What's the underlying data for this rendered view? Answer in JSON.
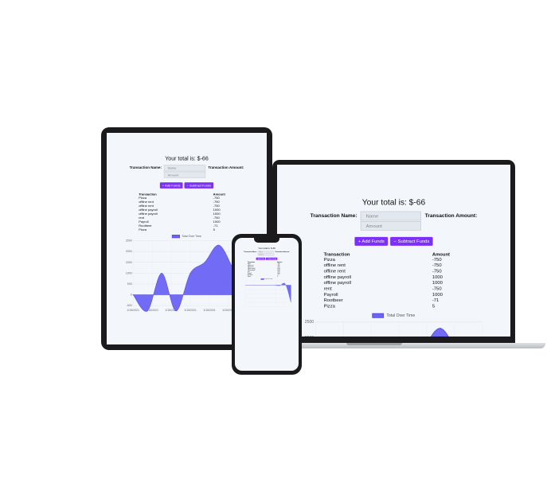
{
  "app": {
    "total_text": "Your total is: $-66",
    "name_label": "Transaction Name:",
    "amount_label": "Transaction Amount:",
    "name_placeholder": "Name",
    "amount_placeholder": "Amount",
    "add_button": "+ Add Funds",
    "subtract_button": "− Subtract Funds",
    "table": {
      "headers": [
        "Transaction",
        "Amount"
      ],
      "rows": [
        [
          "Pizza",
          "-750"
        ],
        [
          "offline rent",
          "-750"
        ],
        [
          "offline rent",
          "-750"
        ],
        [
          "offline payroll",
          "1000"
        ],
        [
          "offline payroll",
          "1000"
        ],
        [
          "rent",
          "-750"
        ],
        [
          "Payroll",
          "1000"
        ],
        [
          "Rootbeer",
          "-71"
        ],
        [
          "Pizza",
          "5"
        ]
      ]
    }
  },
  "chart_data": {
    "type": "area",
    "legend": "Total Over Time",
    "legend_position": "top",
    "grid": true,
    "color": "#6a63f5",
    "x_tick_labels": [
      "1/15/2021",
      "1/15/2021",
      "1/15/2021",
      "1/15/2021",
      "1/15/2021",
      "1/15/2021",
      "1/15/2021"
    ],
    "y_tick_labels": [
      "-500",
      "0",
      "500",
      "1000",
      "1500",
      "2000",
      "2500"
    ],
    "ylim": [
      -500,
      2500
    ],
    "x": [
      0,
      1,
      2,
      3,
      4,
      5,
      6,
      7,
      8
    ],
    "values": [
      0,
      -750,
      1000,
      -750,
      1000,
      1500,
      2300,
      1200,
      -66
    ]
  },
  "phone_chart": {
    "x": [
      0,
      1,
      2,
      3,
      4,
      5,
      6,
      7,
      8
    ],
    "values": [
      0,
      0,
      0,
      0,
      0,
      0,
      -40,
      80,
      -1200
    ],
    "ylim": [
      -1500,
      300
    ]
  }
}
